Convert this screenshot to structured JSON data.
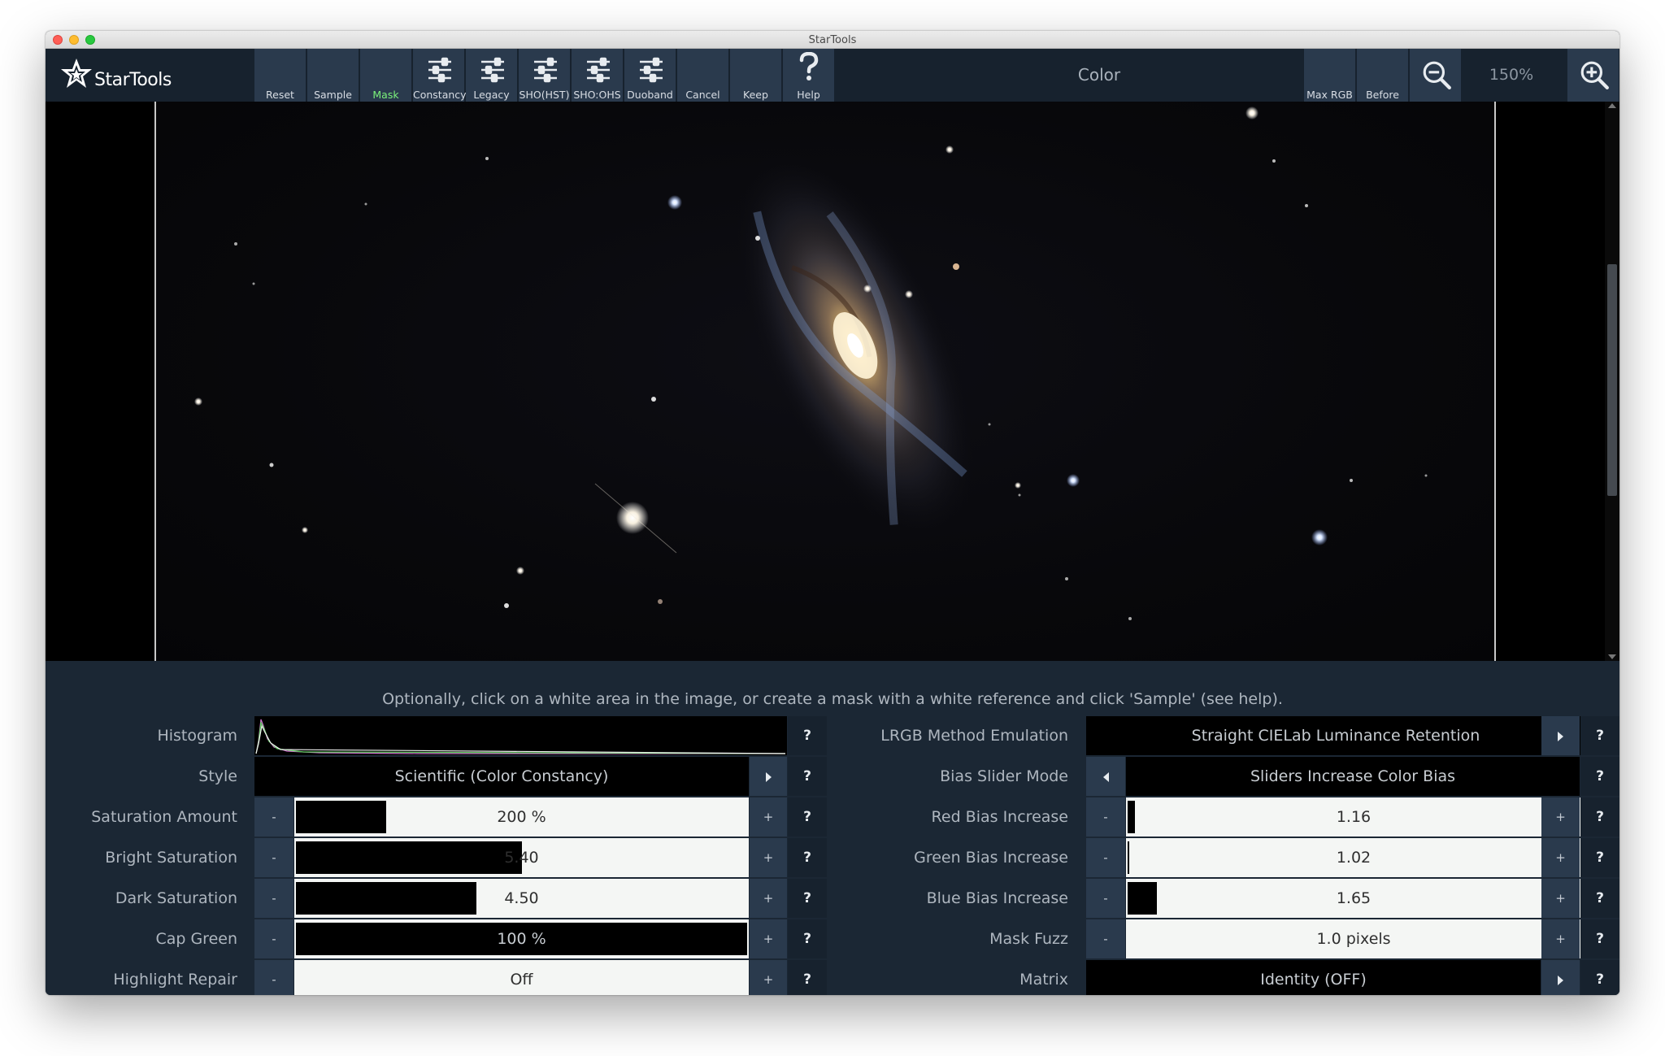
{
  "window": {
    "title": "StarTools"
  },
  "app": {
    "logo_text": "StarTools"
  },
  "toolbar": {
    "buttons": [
      {
        "label": "Reset",
        "icon": "reset-icon",
        "active": false
      },
      {
        "label": "Sample",
        "icon": "sample-icon",
        "active": false
      },
      {
        "label": "Mask",
        "icon": "mask-icon",
        "active": true
      },
      {
        "label": "Constancy",
        "icon": "sliders-icon",
        "active": false
      },
      {
        "label": "Legacy",
        "icon": "sliders-icon",
        "active": false
      },
      {
        "label": "SHO(HST)",
        "icon": "sliders-icon",
        "active": false
      },
      {
        "label": "SHO:OHS",
        "icon": "sliders-icon",
        "active": false
      },
      {
        "label": "Duoband",
        "icon": "sliders-icon",
        "active": false
      },
      {
        "label": "Cancel",
        "icon": "cancel-icon",
        "active": false
      },
      {
        "label": "Keep",
        "icon": "keep-icon",
        "active": false
      },
      {
        "label": "Help",
        "icon": "help-question-icon",
        "active": false
      }
    ],
    "tool_title": "Color",
    "max_rgb_label": "Max RGB",
    "before_label": "Before",
    "zoom_level": "150%",
    "zoom_out_icon": "zoom-out-icon",
    "zoom_in_icon": "zoom-in-icon"
  },
  "hint": "Optionally, click on a white area in the image, or create a mask with a white reference and click 'Sample' (see help).",
  "left_params": {
    "histogram": {
      "label": "Histogram"
    },
    "style": {
      "label": "Style",
      "value": "Scientific (Color Constancy)"
    },
    "saturation_amount": {
      "label": "Saturation Amount",
      "value": "200 %",
      "fraction": 0.2
    },
    "bright_saturation": {
      "label": "Bright Saturation",
      "value": "5.40",
      "fraction": 0.5
    },
    "dark_saturation": {
      "label": "Dark Saturation",
      "value": "4.50",
      "fraction": 0.4
    },
    "cap_green": {
      "label": "Cap Green",
      "value": "100 %",
      "fraction": 1.0
    },
    "highlight_repair": {
      "label": "Highlight Repair",
      "value": "Off",
      "fraction": 0
    }
  },
  "right_params": {
    "lrgb_method": {
      "label": "LRGB Method Emulation",
      "value": "Straight CIELab Luminance Retention"
    },
    "bias_slider_mode": {
      "label": "Bias Slider Mode",
      "value": "Sliders Increase Color Bias"
    },
    "red_bias": {
      "label": "Red Bias Increase",
      "value": "1.16",
      "fraction": 0.016
    },
    "green_bias": {
      "label": "Green Bias Increase",
      "value": "1.02",
      "fraction": 0.003
    },
    "blue_bias": {
      "label": "Blue Bias Increase",
      "value": "1.65",
      "fraction": 0.065
    },
    "mask_fuzz": {
      "label": "Mask Fuzz",
      "value": "1.0 pixels",
      "fraction": 0
    },
    "matrix": {
      "label": "Matrix",
      "value": "Identity (OFF)"
    }
  },
  "controls": {
    "minus": "-",
    "plus": "+",
    "help": "?"
  }
}
